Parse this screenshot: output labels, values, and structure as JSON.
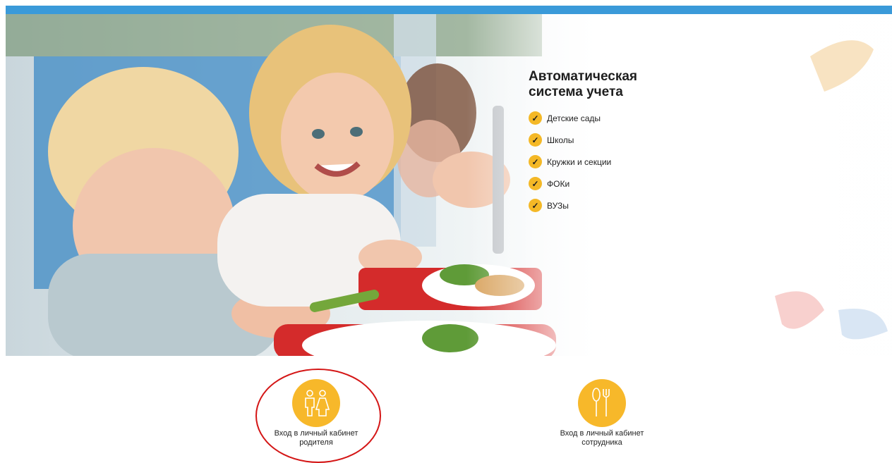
{
  "hero": {
    "title_line1": "Автоматическая",
    "title_line2": "система учета",
    "features": [
      "Детские сады",
      "Школы",
      "Кружки и секции",
      "ФОКи",
      "ВУЗы"
    ]
  },
  "login": {
    "parent": {
      "line1": "Вход в личный кабинет",
      "line2": "родителя"
    },
    "staff": {
      "line1": "Вход в личный кабинет",
      "line2": "сотрудника"
    }
  },
  "colors": {
    "top_bar": "#3a9ad9",
    "accent": "#f7b82a",
    "highlight": "#d41616"
  }
}
